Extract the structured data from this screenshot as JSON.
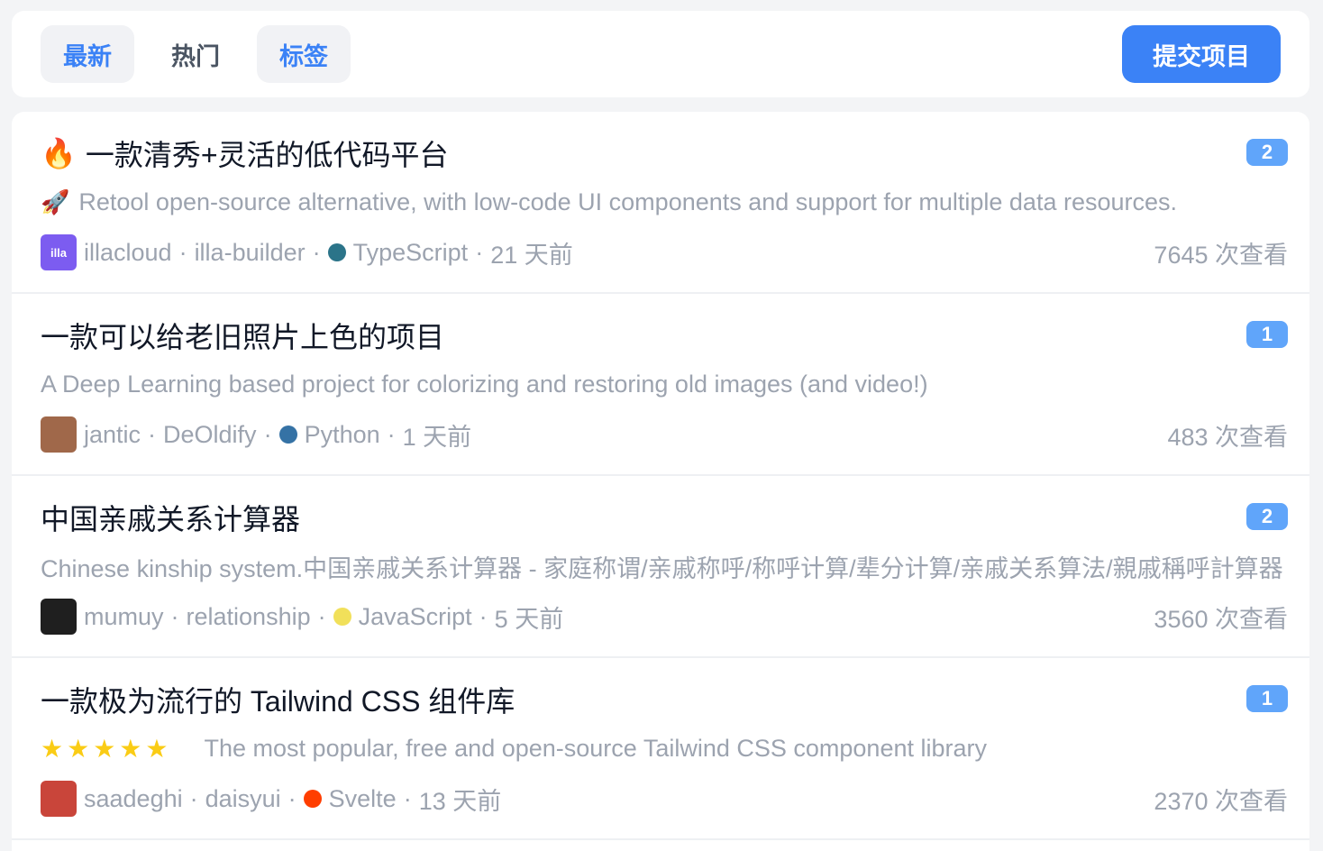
{
  "tabs": {
    "newest": "最新",
    "hot": "热门",
    "tags": "标签"
  },
  "submit_label": "提交项目",
  "items": [
    {
      "fire": "🔥",
      "title": "一款清秀+灵活的低代码平台",
      "badge": "2",
      "desc_emoji": "🚀",
      "desc": "Retool open-source alternative, with low-code UI components and support for multiple data resources.",
      "avatar_text": "illa",
      "avatar_color": "#7c5cf0",
      "owner": "illacloud",
      "repo": "illa-builder",
      "lang": "TypeScript",
      "lang_color": "#2b7489",
      "time": "21 天前",
      "views": "7645 次查看"
    },
    {
      "title": "一款可以给老旧照片上色的项目",
      "badge": "1",
      "desc": "A Deep Learning based project for colorizing and restoring old images (and video!)",
      "avatar_color": "#a0684a",
      "owner": "jantic",
      "repo": "DeOldify",
      "lang": "Python",
      "lang_color": "#3572A5",
      "time": "1 天前",
      "views": "483 次查看"
    },
    {
      "title": "中国亲戚关系计算器",
      "badge": "2",
      "desc": "Chinese kinship system.中国亲戚关系计算器 - 家庭称谓/亲戚称呼/称呼计算/辈分计算/亲戚关系算法/親戚稱呼計算器",
      "avatar_color": "#1f1f1f",
      "owner": "mumuy",
      "repo": "relationship",
      "lang": "JavaScript",
      "lang_color": "#f1e05a",
      "time": "5 天前",
      "views": "3560 次查看"
    },
    {
      "title": "一款极为流行的 Tailwind CSS 组件库",
      "badge": "1",
      "stars": "★★★★★",
      "desc": "The most popular, free and open-source Tailwind CSS component library",
      "avatar_color": "#c9453a",
      "owner": "saadeghi",
      "repo": "daisyui",
      "lang": "Svelte",
      "lang_color": "#ff3e00",
      "time": "13 天前",
      "views": "2370 次查看"
    }
  ]
}
